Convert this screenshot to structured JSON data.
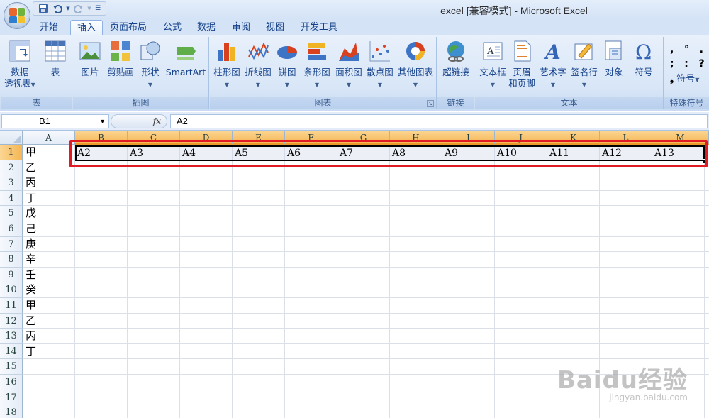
{
  "window": {
    "title": "excel  [兼容模式] - Microsoft Excel"
  },
  "quick_access": {
    "icons": [
      "save-icon",
      "undo-icon",
      "redo-icon",
      "customize-icon"
    ]
  },
  "tabs": [
    {
      "label": "开始",
      "active": false
    },
    {
      "label": "插入",
      "active": true
    },
    {
      "label": "页面布局",
      "active": false
    },
    {
      "label": "公式",
      "active": false
    },
    {
      "label": "数据",
      "active": false
    },
    {
      "label": "审阅",
      "active": false
    },
    {
      "label": "视图",
      "active": false
    },
    {
      "label": "开发工具",
      "active": false
    }
  ],
  "ribbon": {
    "groups": {
      "table": {
        "label": "表",
        "buttons": [
          "数据\n透视表",
          "表"
        ]
      },
      "illustrations": {
        "label": "插图",
        "buttons": [
          "图片",
          "剪贴画",
          "形状",
          "SmartArt"
        ]
      },
      "charts": {
        "label": "图表",
        "buttons": [
          "柱形图",
          "折线图",
          "饼图",
          "条形图",
          "面积图",
          "散点图",
          "其他图表"
        ]
      },
      "links": {
        "label": "链接",
        "buttons": [
          "超链接"
        ]
      },
      "text": {
        "label": "文本",
        "buttons": [
          "文本框",
          "页眉\n和页脚",
          "艺术字",
          "签名行",
          "对象",
          "符号"
        ]
      },
      "special": {
        "label": "特殊符号",
        "symbol_label": "符号"
      }
    },
    "pivot_line1": "数据",
    "pivot_line2": "透视表",
    "header_line1": "页眉",
    "header_line2": "和页脚"
  },
  "formula_bar": {
    "name_box": "B1",
    "fx": "fx",
    "value": "A2"
  },
  "sheet": {
    "columns": [
      "A",
      "B",
      "C",
      "D",
      "E",
      "F",
      "G",
      "H",
      "I",
      "J",
      "K",
      "L",
      "M"
    ],
    "rows": [
      "1",
      "2",
      "3",
      "4",
      "5",
      "6",
      "7",
      "8",
      "9",
      "10",
      "11",
      "12",
      "13",
      "14",
      "15",
      "16",
      "17",
      "18"
    ],
    "column_a": [
      "甲",
      "乙",
      "丙",
      "丁",
      "戊",
      "己",
      "庚",
      "辛",
      "壬",
      "癸",
      "甲",
      "乙",
      "丙",
      "丁"
    ],
    "row1_values": [
      "A2",
      "A3",
      "A4",
      "A5",
      "A6",
      "A7",
      "A8",
      "A9",
      "A10",
      "A11",
      "A12",
      "A13"
    ],
    "selected_columns": [
      "B",
      "C",
      "D",
      "E",
      "F",
      "G",
      "H",
      "I",
      "J",
      "K",
      "L",
      "M"
    ],
    "selected_row": "1",
    "highlight_color": "#e01b24"
  },
  "watermark": {
    "brand": "Baidu经验",
    "url": "jingyan.baidu.com"
  }
}
